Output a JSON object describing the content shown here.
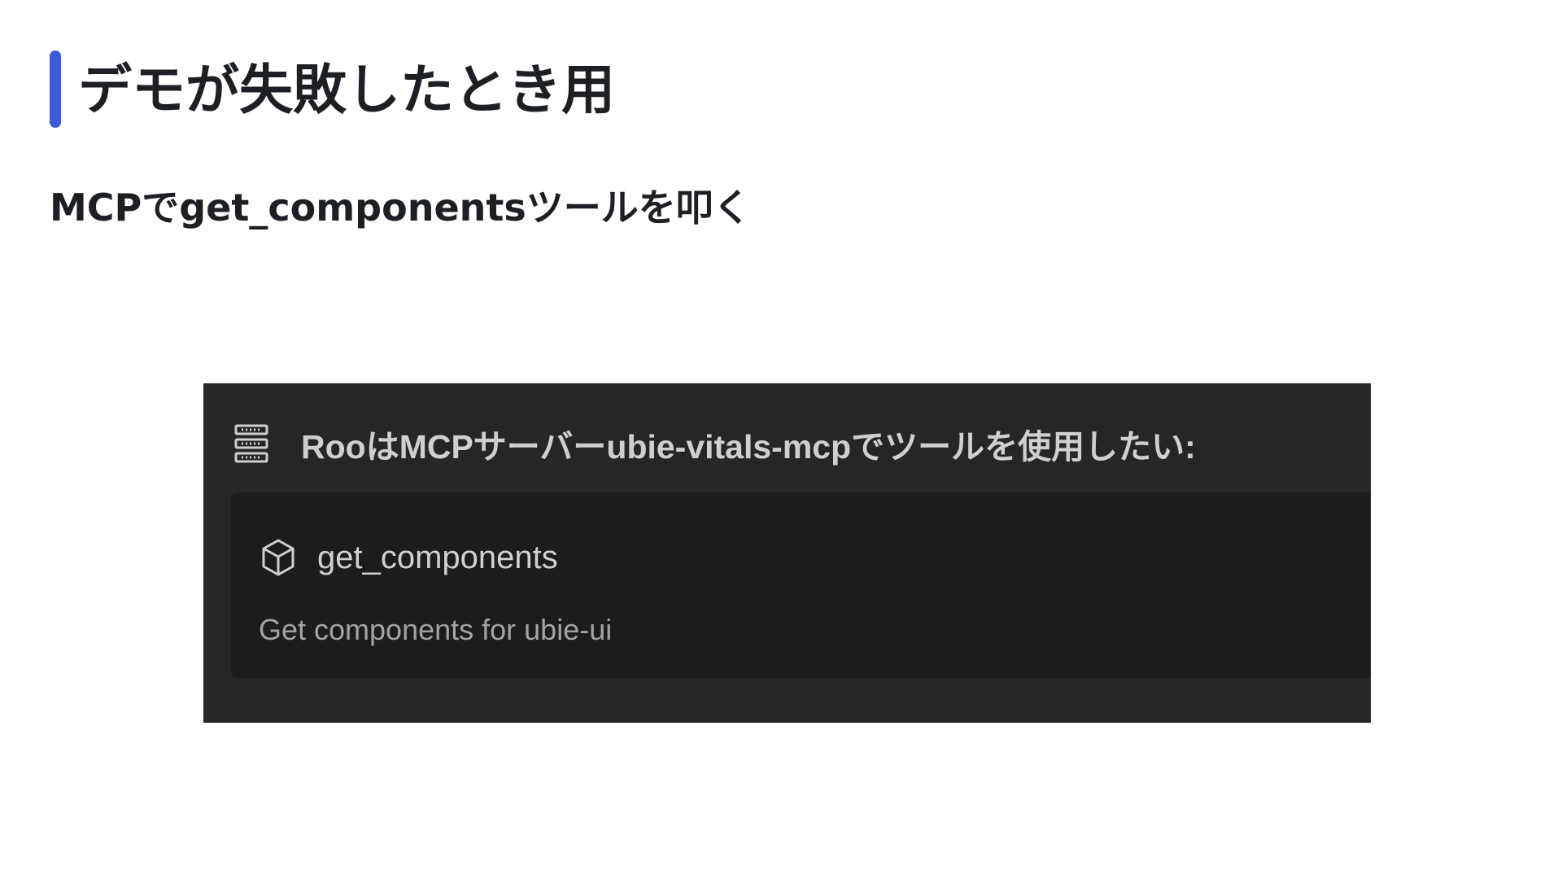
{
  "slide": {
    "title": "デモが失敗したとき用",
    "subtitle": "MCPでget_componentsツールを叩く"
  },
  "screenshot": {
    "header": {
      "icon": "server-icon",
      "text": "RooはMCPサーバーubie-vitals-mcpでツールを使用したい:"
    },
    "tool": {
      "icon": "cube-icon",
      "name": "get_components",
      "description": "Get components for ubie-ui"
    }
  },
  "colors": {
    "accent": "#3b5bdb",
    "panel_background": "#262626",
    "card_background": "#1c1c1c",
    "header_text": "#cfcfcf",
    "description_text": "#a3a3a3"
  }
}
